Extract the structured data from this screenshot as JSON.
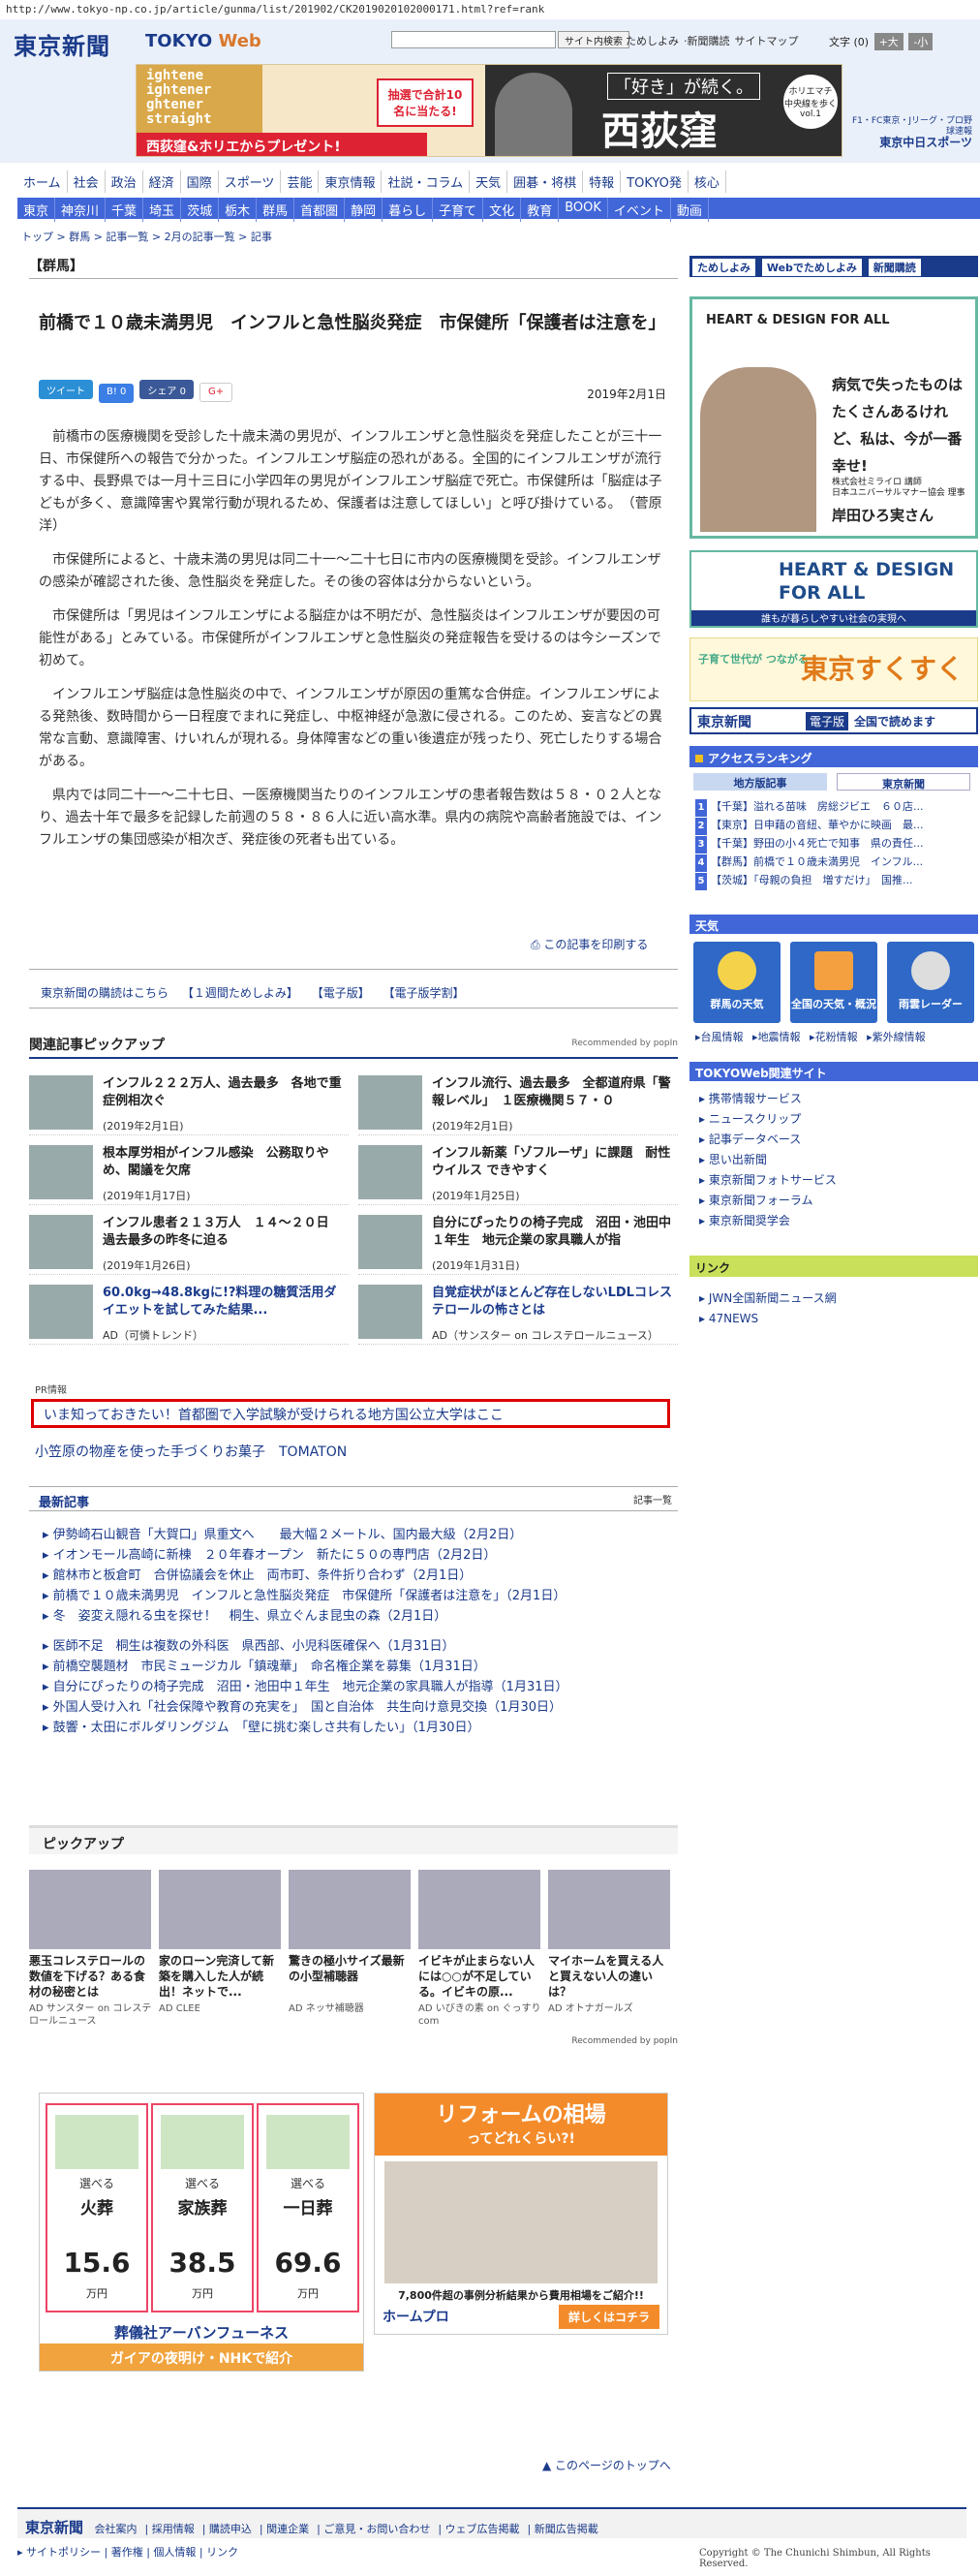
{
  "url": "http://www.tokyo-np.co.jp/article/gunma/list/201902/CK2019020102000171.html?ref=rank",
  "header": {
    "logo": "東京新聞",
    "logo_sub_a": "TOKYO ",
    "logo_sub_b": "Web",
    "search_button": "サイト内検索",
    "links": [
      "ためしよみ",
      "新聞購読",
      "サイトマップ"
    ],
    "fontsize_label": "文字",
    "fontsize_zero": "(0)",
    "fontsize_buttons": [
      "+大",
      "-小"
    ],
    "brand_right_a": "F1・FC東京・Jリーグ・プロ野球速報",
    "brand_right_b": "東京中日スポーツ"
  },
  "banner": {
    "left_text": "ightene\nightener\nghtener\nstraight",
    "red_bar": "西荻窪&ホリエからプレゼント!",
    "lottery": "抽選で合計10名に当たる!",
    "right_small": "「好き」が続く。",
    "right_big": "西荻窪",
    "circle": "ホリエマチ 中央線を歩く vol.1"
  },
  "nav1": [
    "ホーム",
    "社会",
    "政治",
    "経済",
    "国際",
    "スポーツ",
    "芸能",
    "東京情報",
    "社説・コラム",
    "天気",
    "囲碁・将棋",
    "特報",
    "TOKYO発",
    "核心"
  ],
  "nav2": [
    "東京",
    "神奈川",
    "千葉",
    "埼玉",
    "茨城",
    "栃木",
    "群馬",
    "首都圏",
    "静岡",
    "暮らし",
    "子育て",
    "文化",
    "教育",
    "BOOK",
    "イベント",
    "動画"
  ],
  "breadcrumb": "トップ > 群馬 > 記事一覧 > 2月の記事一覧 > 記事",
  "article": {
    "section": "【群馬】",
    "title": "前橋で１０歳未満男児　インフルと急性脳炎発症　市保健所「保護者は注意を」",
    "share": [
      "ツイート",
      "B! 0",
      "シェア 0",
      "G+"
    ],
    "date": "2019年2月1日",
    "paragraphs": [
      "前橋市の医療機関を受診した十歳未満の男児が、インフルエンザと急性脳炎を発症したことが三十一日、市保健所への報告で分かった。インフルエンザ脳症の恐れがある。全国的にインフルエンザが流行する中、長野県では一月十三日に小学四年の男児がインフルエンザ脳症で死亡。市保健所は「脳症は子どもが多く、意識障害や異常行動が現れるため、保護者は注意してほしい」と呼び掛けている。　（菅原洋）",
      "市保健所によると、十歳未満の男児は同二十一〜二十七日に市内の医療機関を受診。インフルエンザの感染が確認された後、急性脳炎を発症した。その後の容体は分からないという。",
      "市保健所は「男児はインフルエンザによる脳症かは不明だが、急性脳炎はインフルエンザが要因の可能性がある」とみている。市保健所がインフルエンザと急性脳炎の発症報告を受けるのは今シーズンで初めて。",
      "インフルエンザ脳症は急性脳炎の中で、インフルエンザが原因の重篤な合併症。インフルエンザによる発熱後、数時間から一日程度でまれに発症し、中枢神経が急激に侵される。このため、妄言などの異常な言動、意識障害、けいれんが現れる。身体障害などの重い後遺症が残ったり、死亡したりする場合がある。",
      "県内では同二十一〜二十七日、一医療機関当たりのインフルエンザの患者報告数は５８・０２人となり、過去十年で最多を記録した前週の５８・８６人に近い高水準。県内の病院や高齢者施設では、インフルエンザの集団感染が相次ぎ、発症後の死者も出ている。"
    ],
    "print": "この記事を印刷する"
  },
  "promo_links": [
    "東京新聞の購読はこちら",
    "【１週間ためしよみ】",
    "【電子版】",
    "【電子版学割】"
  ],
  "pickup": {
    "heading": "関連記事ピックアップ",
    "recommended": "Recommended by popIn",
    "items": [
      {
        "title": "インフル２２２万人、過去最多　各地で重症例相次ぐ",
        "date": "(2019年2月1日)"
      },
      {
        "title": "インフル流行、過去最多　全都道府県「警報レベル」　１医療機関５７・０",
        "date": "(2019年2月1日)"
      },
      {
        "title": "根本厚労相がインフル感染　公務取りやめ、閣議を欠席",
        "date": "(2019年1月17日)"
      },
      {
        "title": "インフル新薬「ゾフルーザ」に課題　耐性ウイルス できやすく",
        "date": "(2019年1月25日)"
      },
      {
        "title": "インフル患者２１３万人　１４〜２０日　過去最多の昨冬に迫る",
        "date": "(2019年1月26日)"
      },
      {
        "title": "自分にぴったりの椅子完成　沼田・池田中１年生　地元企業の家具職人が指",
        "date": "(2019年1月31日)"
      },
      {
        "title": "60.0kg→48.8kgに!?料理の糖質活用ダイエットを試してみた結果...",
        "date": "AD（可憐トレンド）"
      },
      {
        "title": "自覚症状がほとんど存在しないLDLコレステロールの怖さとは",
        "date": "AD（サンスター on コレステロールニュース）"
      }
    ]
  },
  "pr": {
    "label": "PR情報",
    "boxed": "いま知っておきたい！首都圏で入学試験が受けられる地方国公立大学はここ",
    "second": "小笠原の物産を使った手づくりお菓子　TOMATON"
  },
  "latest": {
    "heading": "最新記事",
    "more": "記事一覧",
    "group1": [
      "伊勢崎石山観音「大賀口」県重文へ　　最大幅２メートル、国内最大級（2月2日）",
      "イオンモール高崎に新棟　２０年春オープン　新たに５０の専門店（2月2日）",
      "館林市と板倉町　合併協議会を休止　両市町、条件折り合わず（2月1日）",
      "前橋で１０歳未満男児　インフルと急性脳炎発症　市保健所「保護者は注意を」（2月1日）",
      "冬　姿変え隠れる虫を探せ！　桐生、県立ぐんま昆虫の森（2月1日）"
    ],
    "group2": [
      "医師不足　桐生は複数の外科医　県西部、小児科医確保へ（1月31日）",
      "前橋空襲題材　市民ミュージカル「鎮魂華」　命名権企業を募集（1月31日）",
      "自分にぴったりの椅子完成　沼田・池田中１年生　地元企業の家具職人が指導（1月31日）",
      "外国人受け入れ「社会保障や教育の充実を」　国と自治体　共生向け意見交換（1月30日）",
      "鼓響・太田にボルダリングジム　「壁に挑む楽しさ共有したい」（1月30日）"
    ]
  },
  "pickup2": {
    "heading": "ピックアップ",
    "items": [
      {
        "title": "悪玉コレステロールの数値を下げる？ある食材の秘密とは",
        "ad": "AD サンスター on コレステロールニュース"
      },
      {
        "title": "家のローン完済して新築を購入した人が続出！ネットで...",
        "ad": "AD CLEE"
      },
      {
        "title": "驚きの極小サイズ最新の小型補聴器",
        "ad": "AD ネッサ補聴器"
      },
      {
        "title": "イビキが止まらない人には○○が不足している。イビキの原...",
        "ad": "AD いびきの素 on ぐっすりcom"
      },
      {
        "title": "マイホームを買える人と買えない人の違いは？",
        "ad": "AD オトナガールズ"
      }
    ],
    "recommended": "Recommended by popIn"
  },
  "ad_left": {
    "cols": [
      {
        "prefix": "選べる",
        "label": "火葬",
        "price": "15.6",
        "unit": "万円"
      },
      {
        "prefix": "選べる",
        "label": "家族葬",
        "price": "38.5",
        "unit": "万円"
      },
      {
        "prefix": "選べる",
        "label": "一日葬",
        "price": "69.6",
        "unit": "万円"
      }
    ],
    "company": "葬儀社アーバンフューネス",
    "gaia": "ガイアの夜明け・NHKで紹介"
  },
  "ad_right": {
    "title": "リフォームの相場",
    "sub": "ってどれくらい?!",
    "note": "7,800件超の事例分析結果から費用相場をご紹介!!",
    "brand": "ホームプロ",
    "button": "詳しくはコチラ"
  },
  "pagetop": "このページのトップへ",
  "footer": {
    "logo": "東京新聞",
    "links": [
      "会社案内",
      "採用情報",
      "購読申込",
      "関連企業",
      "ご意見・お問い合わせ",
      "ウェブ広告掲載",
      "新聞広告掲載"
    ],
    "links2": [
      "サイトポリシー",
      "著作権",
      "個人情報",
      "リンク"
    ],
    "copyright": "Copyright © The Chunichi Shimbun, All Rights Reserved."
  },
  "sidebar": {
    "top_buttons": [
      "ためしよみ",
      "Webでためしよみ",
      "新聞購読"
    ],
    "ad1": {
      "logo": "HEART & DESIGN FOR ALL",
      "quote": "病気で失ったものはたくさんあるけれど、私は、今が一番幸せ!",
      "caption": "株式会社ミライロ 講師\n日本ユニバーサルマナー協会 理事",
      "name": "岸田ひろ実さん"
    },
    "ad2": {
      "title": "HEART & DESIGN FOR ALL",
      "bar": "誰もが暮らしやすい社会の実現へ"
    },
    "ad3": {
      "a": "子育て世代が つながる",
      "b": "東京すくすく"
    },
    "ad4": {
      "logo": "東京新聞",
      "mid": "電子版",
      "right": "全国で読めます"
    },
    "ranking": {
      "heading": "アクセスランキング",
      "tabs": [
        "地方版記事",
        "東京新聞"
      ],
      "items": [
        "【千葉】溢れる苗味　房総ジビエ　６０店...",
        "【東京】日申藉の音紐、華やかに映画　最...",
        "【千葉】野田の小４死亡で知事　県の責任...",
        "【群馬】前橋で１０歳未満男児　インフル...",
        "【茨城】「母親の負担　増すだけ」　国推..."
      ]
    },
    "weather": {
      "heading": "天気",
      "boxes": [
        "群馬の天気",
        "全国の天気・概況",
        "雨雲レーダー"
      ],
      "links": [
        "台風情報",
        "地震情報",
        "花粉情報",
        "紫外線情報"
      ]
    },
    "sites": {
      "heading": "TOKYOWeb関連サイト",
      "items": [
        "携帯情報サービス",
        "ニュースクリップ",
        "記事データベース",
        "思い出新聞",
        "東京新聞フォトサービス",
        "東京新聞フォーラム",
        "東京新聞奨学会"
      ]
    },
    "links": {
      "heading": "リンク",
      "items": [
        "JWN全国新聞ニュース網",
        "47NEWS"
      ]
    }
  }
}
